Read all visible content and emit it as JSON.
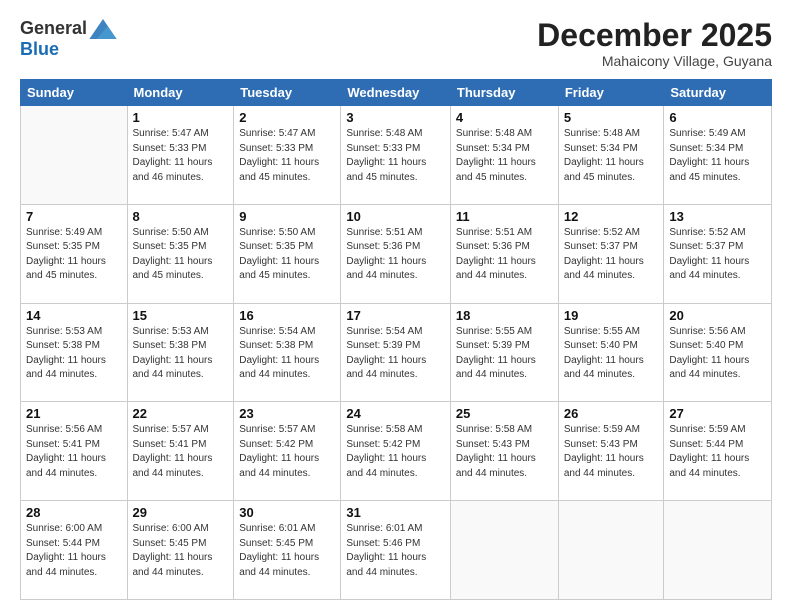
{
  "logo": {
    "general": "General",
    "blue": "Blue"
  },
  "header": {
    "month": "December 2025",
    "location": "Mahaicony Village, Guyana"
  },
  "weekdays": [
    "Sunday",
    "Monday",
    "Tuesday",
    "Wednesday",
    "Thursday",
    "Friday",
    "Saturday"
  ],
  "weeks": [
    [
      {
        "day": "",
        "sunrise": "",
        "sunset": "",
        "daylight": ""
      },
      {
        "day": "1",
        "sunrise": "Sunrise: 5:47 AM",
        "sunset": "Sunset: 5:33 PM",
        "daylight": "Daylight: 11 hours and 46 minutes."
      },
      {
        "day": "2",
        "sunrise": "Sunrise: 5:47 AM",
        "sunset": "Sunset: 5:33 PM",
        "daylight": "Daylight: 11 hours and 45 minutes."
      },
      {
        "day": "3",
        "sunrise": "Sunrise: 5:48 AM",
        "sunset": "Sunset: 5:33 PM",
        "daylight": "Daylight: 11 hours and 45 minutes."
      },
      {
        "day": "4",
        "sunrise": "Sunrise: 5:48 AM",
        "sunset": "Sunset: 5:34 PM",
        "daylight": "Daylight: 11 hours and 45 minutes."
      },
      {
        "day": "5",
        "sunrise": "Sunrise: 5:48 AM",
        "sunset": "Sunset: 5:34 PM",
        "daylight": "Daylight: 11 hours and 45 minutes."
      },
      {
        "day": "6",
        "sunrise": "Sunrise: 5:49 AM",
        "sunset": "Sunset: 5:34 PM",
        "daylight": "Daylight: 11 hours and 45 minutes."
      }
    ],
    [
      {
        "day": "7",
        "sunrise": "Sunrise: 5:49 AM",
        "sunset": "Sunset: 5:35 PM",
        "daylight": "Daylight: 11 hours and 45 minutes."
      },
      {
        "day": "8",
        "sunrise": "Sunrise: 5:50 AM",
        "sunset": "Sunset: 5:35 PM",
        "daylight": "Daylight: 11 hours and 45 minutes."
      },
      {
        "day": "9",
        "sunrise": "Sunrise: 5:50 AM",
        "sunset": "Sunset: 5:35 PM",
        "daylight": "Daylight: 11 hours and 45 minutes."
      },
      {
        "day": "10",
        "sunrise": "Sunrise: 5:51 AM",
        "sunset": "Sunset: 5:36 PM",
        "daylight": "Daylight: 11 hours and 44 minutes."
      },
      {
        "day": "11",
        "sunrise": "Sunrise: 5:51 AM",
        "sunset": "Sunset: 5:36 PM",
        "daylight": "Daylight: 11 hours and 44 minutes."
      },
      {
        "day": "12",
        "sunrise": "Sunrise: 5:52 AM",
        "sunset": "Sunset: 5:37 PM",
        "daylight": "Daylight: 11 hours and 44 minutes."
      },
      {
        "day": "13",
        "sunrise": "Sunrise: 5:52 AM",
        "sunset": "Sunset: 5:37 PM",
        "daylight": "Daylight: 11 hours and 44 minutes."
      }
    ],
    [
      {
        "day": "14",
        "sunrise": "Sunrise: 5:53 AM",
        "sunset": "Sunset: 5:38 PM",
        "daylight": "Daylight: 11 hours and 44 minutes."
      },
      {
        "day": "15",
        "sunrise": "Sunrise: 5:53 AM",
        "sunset": "Sunset: 5:38 PM",
        "daylight": "Daylight: 11 hours and 44 minutes."
      },
      {
        "day": "16",
        "sunrise": "Sunrise: 5:54 AM",
        "sunset": "Sunset: 5:38 PM",
        "daylight": "Daylight: 11 hours and 44 minutes."
      },
      {
        "day": "17",
        "sunrise": "Sunrise: 5:54 AM",
        "sunset": "Sunset: 5:39 PM",
        "daylight": "Daylight: 11 hours and 44 minutes."
      },
      {
        "day": "18",
        "sunrise": "Sunrise: 5:55 AM",
        "sunset": "Sunset: 5:39 PM",
        "daylight": "Daylight: 11 hours and 44 minutes."
      },
      {
        "day": "19",
        "sunrise": "Sunrise: 5:55 AM",
        "sunset": "Sunset: 5:40 PM",
        "daylight": "Daylight: 11 hours and 44 minutes."
      },
      {
        "day": "20",
        "sunrise": "Sunrise: 5:56 AM",
        "sunset": "Sunset: 5:40 PM",
        "daylight": "Daylight: 11 hours and 44 minutes."
      }
    ],
    [
      {
        "day": "21",
        "sunrise": "Sunrise: 5:56 AM",
        "sunset": "Sunset: 5:41 PM",
        "daylight": "Daylight: 11 hours and 44 minutes."
      },
      {
        "day": "22",
        "sunrise": "Sunrise: 5:57 AM",
        "sunset": "Sunset: 5:41 PM",
        "daylight": "Daylight: 11 hours and 44 minutes."
      },
      {
        "day": "23",
        "sunrise": "Sunrise: 5:57 AM",
        "sunset": "Sunset: 5:42 PM",
        "daylight": "Daylight: 11 hours and 44 minutes."
      },
      {
        "day": "24",
        "sunrise": "Sunrise: 5:58 AM",
        "sunset": "Sunset: 5:42 PM",
        "daylight": "Daylight: 11 hours and 44 minutes."
      },
      {
        "day": "25",
        "sunrise": "Sunrise: 5:58 AM",
        "sunset": "Sunset: 5:43 PM",
        "daylight": "Daylight: 11 hours and 44 minutes."
      },
      {
        "day": "26",
        "sunrise": "Sunrise: 5:59 AM",
        "sunset": "Sunset: 5:43 PM",
        "daylight": "Daylight: 11 hours and 44 minutes."
      },
      {
        "day": "27",
        "sunrise": "Sunrise: 5:59 AM",
        "sunset": "Sunset: 5:44 PM",
        "daylight": "Daylight: 11 hours and 44 minutes."
      }
    ],
    [
      {
        "day": "28",
        "sunrise": "Sunrise: 6:00 AM",
        "sunset": "Sunset: 5:44 PM",
        "daylight": "Daylight: 11 hours and 44 minutes."
      },
      {
        "day": "29",
        "sunrise": "Sunrise: 6:00 AM",
        "sunset": "Sunset: 5:45 PM",
        "daylight": "Daylight: 11 hours and 44 minutes."
      },
      {
        "day": "30",
        "sunrise": "Sunrise: 6:01 AM",
        "sunset": "Sunset: 5:45 PM",
        "daylight": "Daylight: 11 hours and 44 minutes."
      },
      {
        "day": "31",
        "sunrise": "Sunrise: 6:01 AM",
        "sunset": "Sunset: 5:46 PM",
        "daylight": "Daylight: 11 hours and 44 minutes."
      },
      {
        "day": "",
        "sunrise": "",
        "sunset": "",
        "daylight": ""
      },
      {
        "day": "",
        "sunrise": "",
        "sunset": "",
        "daylight": ""
      },
      {
        "day": "",
        "sunrise": "",
        "sunset": "",
        "daylight": ""
      }
    ]
  ]
}
